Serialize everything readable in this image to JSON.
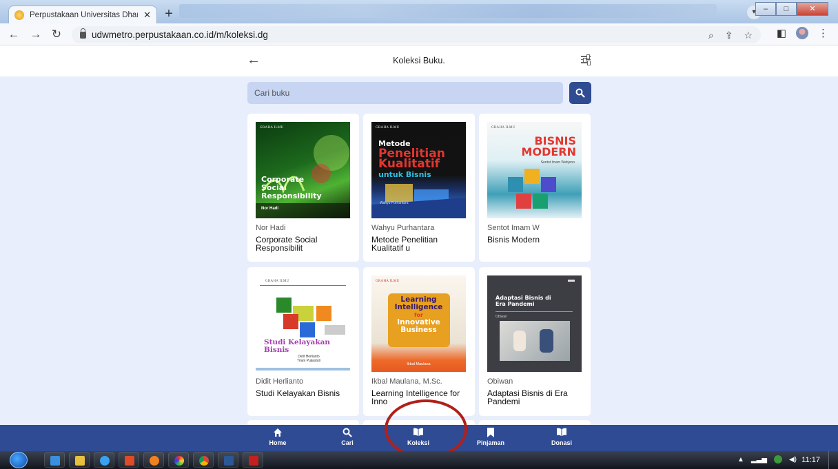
{
  "browser": {
    "tab_title": "Perpustakaan Universitas Dharma",
    "url": "udwmetro.perpustakaan.co.id/m/koleksi.dg"
  },
  "header": {
    "title": "Koleksi Buku."
  },
  "search": {
    "placeholder": "Cari buku"
  },
  "books": [
    {
      "author": "Nor Hadi",
      "title": "Corporate Social Responsibilit",
      "icon": "book-cover"
    },
    {
      "author": "Wahyu Purhantara",
      "title": "Metode Penelitian Kualitatif u",
      "icon": "book-cover"
    },
    {
      "author": "Sentot Imam W",
      "title": "Bisnis Modern",
      "icon": "book-cover"
    },
    {
      "author": "Didit Herlianto",
      "title": "Studi Kelayakan Bisnis",
      "icon": "book-cover"
    },
    {
      "author": "Ikbal Maulana, M.Sc.",
      "title": "Learning Intelligence for Inno",
      "icon": "book-cover"
    },
    {
      "author": "Obiwan",
      "title": "Adaptasi Bisnis di Era Pandemi",
      "icon": "book-cover"
    }
  ],
  "covers": {
    "publisher": "GRAHA ILMU",
    "c1": {
      "lines": [
        "Corporate",
        "Social",
        "Responsibility"
      ],
      "author": "Nor Hadi"
    },
    "c2": {
      "lines": [
        "Metode",
        "Penelitian",
        "Kualitatif",
        "untuk Bisnis"
      ],
      "author": "Wahyu Purhantara"
    },
    "c3": {
      "lines": [
        "BISNIS",
        "MODERN"
      ],
      "author": "Sentot Imam Wahjono"
    },
    "c4": {
      "lines": [
        "Studi Kelayakan",
        "Bisnis"
      ],
      "author1": "Didit Herlianto",
      "author2": "Triani Pujiastuti"
    },
    "c5": {
      "lines": [
        "Learning",
        "Intelligence",
        "for",
        "Innovative",
        "Business"
      ],
      "author": "Ikbal Maulana"
    },
    "c6": {
      "lines": [
        "Adaptasi Bisnis di",
        "Era Pandemi"
      ],
      "author": "Obiwan"
    }
  },
  "bottom_nav": [
    {
      "label": "Home",
      "icon": "home-icon"
    },
    {
      "label": "Cari",
      "icon": "search-icon"
    },
    {
      "label": "Koleksi",
      "icon": "book-open-icon"
    },
    {
      "label": "Pinjaman",
      "icon": "bookmark-icon"
    },
    {
      "label": "Donasi",
      "icon": "book-open-icon"
    }
  ],
  "taskbar": {
    "clock": "11:17"
  },
  "colors": {
    "nav_blue": "#2f4b93",
    "page_bg": "#e8eefb",
    "search_bg": "#c7d5f3",
    "highlight_ring": "#b1201a"
  }
}
